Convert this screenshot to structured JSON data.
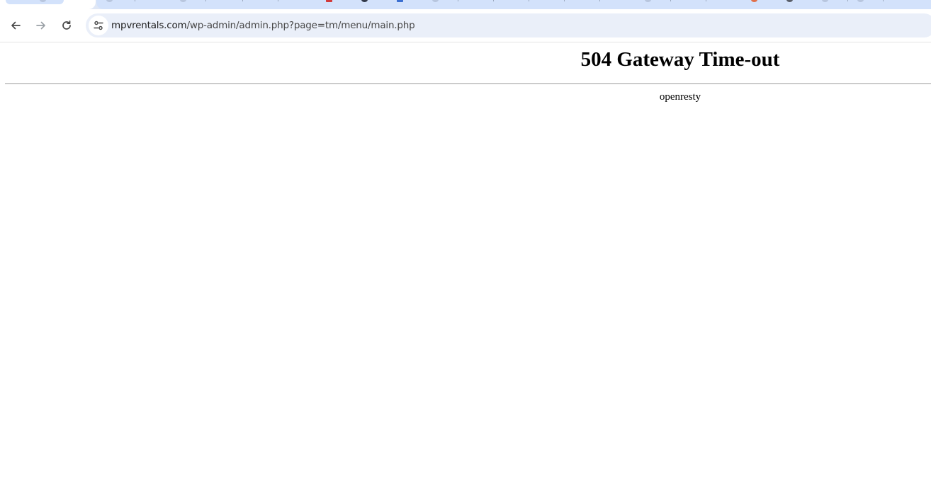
{
  "browser": {
    "address_bar": {
      "url_host": "mpvrentals.com",
      "url_path": "/wp-admin/admin.php?page=tm/menu/main.php"
    },
    "nav_icons": [
      "back-arrow-icon",
      "forward-arrow-icon",
      "reload-icon",
      "site-info-icon"
    ],
    "colors": {
      "tabstrip": "#dfe7f6",
      "omnibox": "#eaeff9"
    }
  },
  "page": {
    "heading": "504 Gateway Time-out",
    "server_name": "openresty"
  }
}
